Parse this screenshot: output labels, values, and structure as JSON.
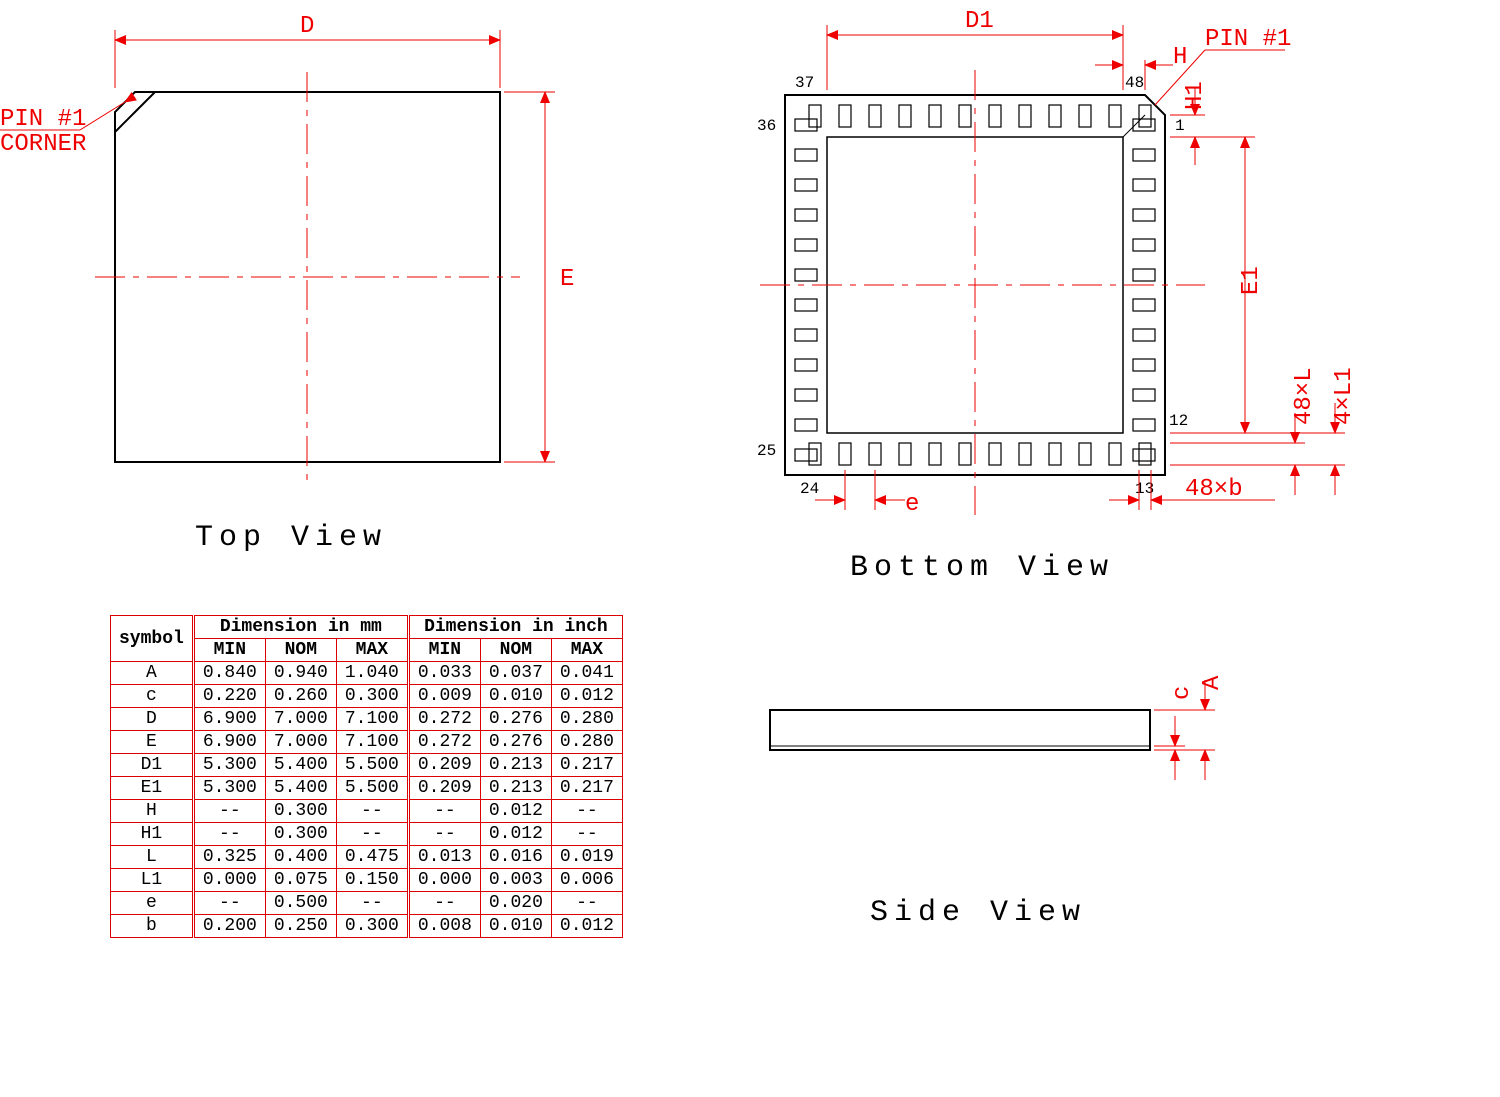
{
  "titles": {
    "top": "Top View",
    "bottom": "Bottom View",
    "side": "Side View"
  },
  "labels": {
    "pin1corner_a": "PIN #1",
    "pin1corner_b": "CORNER",
    "pin1": "PIN #1",
    "D": "D",
    "E": "E",
    "D1": "D1",
    "E1": "E1",
    "H": "H",
    "H1": "H1",
    "e": "e",
    "c": "c",
    "A": "A",
    "b48": "48×b",
    "L48": "48×L",
    "L14": "4×L1",
    "p1": "1",
    "p12": "12",
    "p13": "13",
    "p24": "24",
    "p25": "25",
    "p36": "36",
    "p37": "37",
    "p48": "48"
  },
  "table": {
    "h_sym": "symbol",
    "h_mm": "Dimension in mm",
    "h_in": "Dimension in inch",
    "h_min": "MIN",
    "h_nom": "NOM",
    "h_max": "MAX",
    "rows": [
      {
        "s": "A",
        "a": "0.840",
        "b": "0.940",
        "c": "1.040",
        "d": "0.033",
        "e": "0.037",
        "f": "0.041"
      },
      {
        "s": "c",
        "a": "0.220",
        "b": "0.260",
        "c": "0.300",
        "d": "0.009",
        "e": "0.010",
        "f": "0.012"
      },
      {
        "s": "D",
        "a": "6.900",
        "b": "7.000",
        "c": "7.100",
        "d": "0.272",
        "e": "0.276",
        "f": "0.280"
      },
      {
        "s": "E",
        "a": "6.900",
        "b": "7.000",
        "c": "7.100",
        "d": "0.272",
        "e": "0.276",
        "f": "0.280"
      },
      {
        "s": "D1",
        "a": "5.300",
        "b": "5.400",
        "c": "5.500",
        "d": "0.209",
        "e": "0.213",
        "f": "0.217"
      },
      {
        "s": "E1",
        "a": "5.300",
        "b": "5.400",
        "c": "5.500",
        "d": "0.209",
        "e": "0.213",
        "f": "0.217"
      },
      {
        "s": "H",
        "a": "--",
        "b": "0.300",
        "c": "--",
        "d": "--",
        "e": "0.012",
        "f": "--"
      },
      {
        "s": "H1",
        "a": "--",
        "b": "0.300",
        "c": "--",
        "d": "--",
        "e": "0.012",
        "f": "--"
      },
      {
        "s": "L",
        "a": "0.325",
        "b": "0.400",
        "c": "0.475",
        "d": "0.013",
        "e": "0.016",
        "f": "0.019"
      },
      {
        "s": "L1",
        "a": "0.000",
        "b": "0.075",
        "c": "0.150",
        "d": "0.000",
        "e": "0.003",
        "f": "0.006"
      },
      {
        "s": "e",
        "a": "--",
        "b": "0.500",
        "c": "--",
        "d": "--",
        "e": "0.020",
        "f": "--"
      },
      {
        "s": "b",
        "a": "0.200",
        "b": "0.250",
        "c": "0.300",
        "d": "0.008",
        "e": "0.010",
        "f": "0.012"
      }
    ]
  }
}
